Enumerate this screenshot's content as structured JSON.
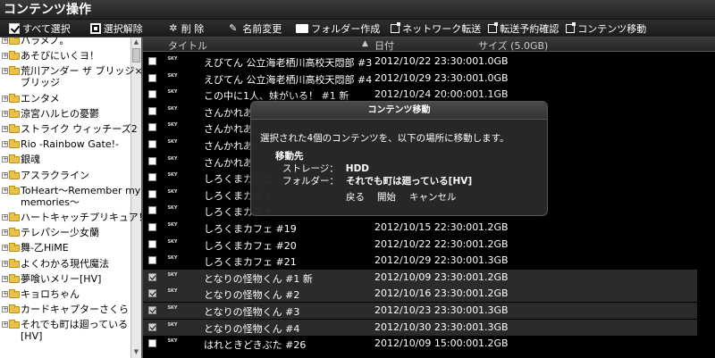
{
  "window": {
    "title": "コンテンツ操作"
  },
  "toolbar": {
    "select_all": "すべて選択",
    "deselect": "選択解除",
    "delete": "削 除",
    "rename": "名前変更",
    "new_folder": "フォルダー作成",
    "network_transfer": "ネットワーク転送",
    "transfer_schedule": "転送予約確認",
    "content_move": "コンテンツ移動"
  },
  "sidebar": {
    "items": [
      {
        "label": "ハラメノ。"
      },
      {
        "label": "あそびにいくヨ！"
      },
      {
        "label": "荒川アンダー ザ ブリッジ×"
      },
      {
        "label": "ブリッジ"
      },
      {
        "label": "エンタメ"
      },
      {
        "label": "涼宮ハルヒの憂鬱"
      },
      {
        "label": "ストライク ウィッチーズ2"
      },
      {
        "label": "Rio -Rainbow Gate!-"
      },
      {
        "label": "銀魂"
      },
      {
        "label": "アスラクライン"
      },
      {
        "label": "ToHeart～Remember my"
      },
      {
        "label": "memories～"
      },
      {
        "label": "ハートキャッチプリキュア！"
      },
      {
        "label": "テレパシー少女蘭"
      },
      {
        "label": "舞-乙HiME"
      },
      {
        "label": "よくわかる現代魔法"
      },
      {
        "label": "夢喰いメリー[HV]"
      },
      {
        "label": "キョロちゃん"
      },
      {
        "label": "カードキャプターさくら"
      },
      {
        "label": "それでも町は廻っている"
      },
      {
        "label": "[HV]"
      }
    ]
  },
  "list": {
    "headers": {
      "title": "タイトル",
      "date": "日付",
      "size": "サイズ (5.0GB)"
    },
    "logo_text": "SKY",
    "rows": [
      {
        "title": "えびてん 公立海老栖川高校天悶部 #3",
        "date": "2012/10/22 23:30:00",
        "size": "1.0GB",
        "selected": false
      },
      {
        "title": "えびてん 公立海老栖川高校天悶部 #4",
        "date": "2012/10/29 23:30:00",
        "size": "1.0GB",
        "selected": false
      },
      {
        "title": "この中に1人、妹がいる！ #1 新",
        "date": "2012/10/24 20:00:00",
        "size": "1.1GB",
        "selected": false
      },
      {
        "title": "さんかれあ",
        "date": "",
        "size": "",
        "selected": false
      },
      {
        "title": "さんかれあ",
        "date": "",
        "size": "",
        "selected": false
      },
      {
        "title": "さんかれあ",
        "date": "",
        "size": "",
        "selected": false
      },
      {
        "title": "さんかれあ",
        "date": "",
        "size": "",
        "selected": false
      },
      {
        "title": "しろくまカフェ",
        "date": "",
        "size": "",
        "selected": false
      },
      {
        "title": "しろくまカフェ",
        "date": "",
        "size": "",
        "selected": false
      },
      {
        "title": "しろくまカフェ",
        "date": "",
        "size": "",
        "selected": false
      },
      {
        "title": "しろくまカフェ #19",
        "date": "2012/10/15 22:30:00",
        "size": "1.2GB",
        "selected": false
      },
      {
        "title": "しろくまカフェ #20",
        "date": "2012/10/22 22:30:00",
        "size": "1.2GB",
        "selected": false
      },
      {
        "title": "しろくまカフェ #21",
        "date": "2012/10/29 22:30:00",
        "size": "1.3GB",
        "selected": false
      },
      {
        "title": "となりの怪物くん #1 新",
        "date": "2012/10/09 23:30:00",
        "size": "1.2GB",
        "selected": true
      },
      {
        "title": "となりの怪物くん #2",
        "date": "2012/10/16 23:30:00",
        "size": "1.2GB",
        "selected": true
      },
      {
        "title": "となりの怪物くん #3",
        "date": "2012/10/23 23:30:00",
        "size": "1.3GB",
        "selected": true
      },
      {
        "title": "となりの怪物くん #4",
        "date": "2012/10/30 23:30:00",
        "size": "1.3GB",
        "selected": true
      },
      {
        "title": "はれときどきぶた #26",
        "date": "2012/10/09 15:00:00",
        "size": "1.2GB",
        "selected": false
      }
    ]
  },
  "dialog": {
    "title": "コンテンツ移動",
    "message": "選択された4個のコンテンツを、以下の場所に移動します。",
    "destination_label": "移動先",
    "storage_label": "ストレージ：",
    "storage_value": "HDD",
    "folder_label": "フォルダー：",
    "folder_value": "それでも町は廻っている[HV]",
    "back_button": "戻る",
    "start_button": "開始",
    "cancel_button": "キャンセル"
  }
}
